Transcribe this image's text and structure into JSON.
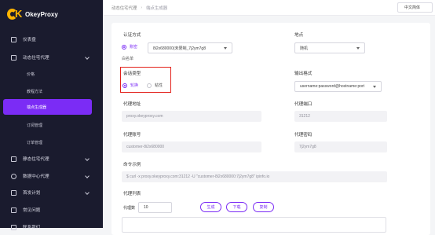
{
  "brand": {
    "name": "OkeyProxy"
  },
  "sidebar": {
    "items": [
      {
        "label": "仪表盘",
        "icon": "monitor-icon"
      },
      {
        "label": "动态住宅代理",
        "icon": "home-icon"
      },
      {
        "label": "价格"
      },
      {
        "label": "教程方法"
      },
      {
        "label": "端点生成器"
      },
      {
        "label": "订阅管理"
      },
      {
        "label": "订单管理"
      },
      {
        "label": "静态住宅代理",
        "icon": "server-icon"
      },
      {
        "label": "数据中心代理",
        "icon": "globe-icon"
      },
      {
        "label": "首发计划",
        "icon": "calendar-icon"
      },
      {
        "label": "常见问题",
        "icon": "help-icon"
      },
      {
        "label": "联系我们",
        "icon": "contact-icon"
      }
    ]
  },
  "header": {
    "breadcrumb": [
      "动态住宅代理",
      "端点生成器"
    ],
    "language": "中文简体"
  },
  "form": {
    "auth_label": "认证方式",
    "auth_options": [
      "账密",
      "白名单"
    ],
    "account_value": "8i2x680000(未限制_7j2ym7g8",
    "location_label": "地点",
    "location_value": "随机",
    "session_label": "会话类型",
    "session_options": [
      "轮换",
      "粘性"
    ],
    "output_label": "输出格式",
    "output_value": "username:password@hostname:port",
    "proxy_addr_label": "代理地址",
    "proxy_addr_value": "proxy.okeyproxy.com",
    "proxy_port_label": "代理端口",
    "proxy_port_value": "31212",
    "proxy_user_label": "代理账号",
    "proxy_user_value": "customer-8i2x680000",
    "proxy_pass_label": "代理密码",
    "proxy_pass_value": "7j2ym7g8",
    "cmd_label": "命令示例",
    "cmd_value": "$ curl -x proxy.okeyproxy.com:31212 -U \"customer-8i2x680000:7j2ym7g8\" ipinfo.io",
    "list_label": "代理列表",
    "count_label": "代理数",
    "count_value": "10",
    "btn_generate": "生成",
    "btn_download": "下载",
    "btn_copy": "复制"
  },
  "colors": {
    "accent": "#7b2cf5",
    "sidebar_bg": "#1a1b2e",
    "highlight": "#e3211b"
  }
}
